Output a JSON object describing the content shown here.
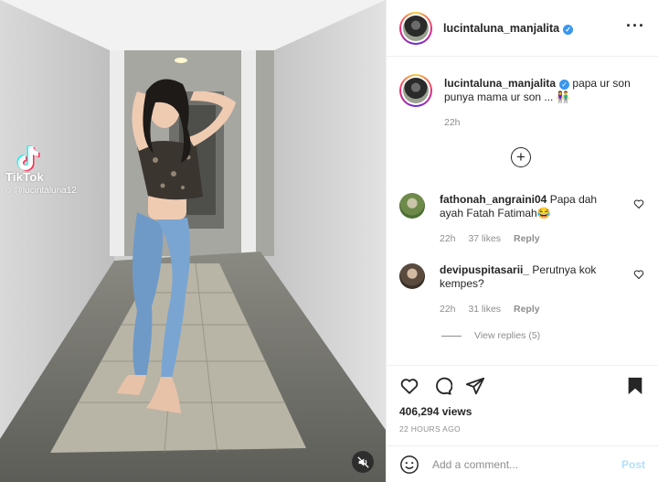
{
  "media": {
    "watermark_brand": "TikTok",
    "watermark_user": "@lucintaluna12",
    "mute_icon": "speaker-muted-icon"
  },
  "header": {
    "username": "lucintaluna_manjalita",
    "verified_icon": "verified-badge-icon",
    "more_icon": "more-options-icon"
  },
  "caption": {
    "username": "lucintaluna_manjalita",
    "text": "papa ur son punya mama ur son ... 👫",
    "time": "22h"
  },
  "load_more_icon": "plus-circle-icon",
  "comments": [
    {
      "username": "fathonah_angraini04",
      "text": "Papa dah ayah Fatah Fatimah😂",
      "time": "22h",
      "likes": "37 likes",
      "reply": "Reply"
    },
    {
      "username": "devipuspitasarii_",
      "text": "Perutnya kok kempes?",
      "time": "22h",
      "likes": "31 likes",
      "reply": "Reply",
      "view_replies": "View replies (5)"
    }
  ],
  "actions": {
    "views": "406,294 views",
    "posted": "22 HOURS AGO"
  },
  "add_comment": {
    "placeholder": "Add a comment...",
    "post_label": "Post"
  },
  "colors": {
    "accent": "#3897f0",
    "post_disabled": "#b2dffc",
    "muted_text": "#8e8e8e"
  }
}
